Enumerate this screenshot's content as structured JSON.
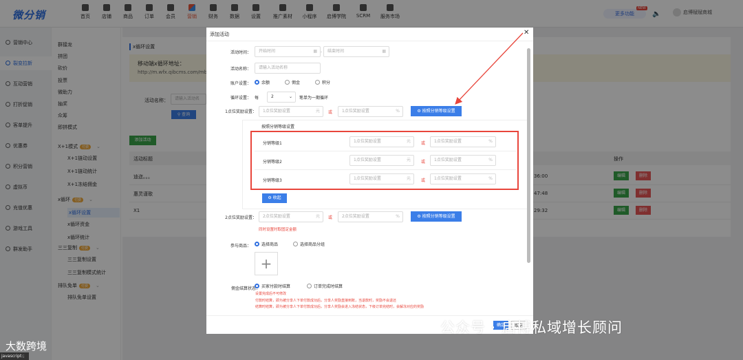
{
  "app": {
    "logo_text": "微分销",
    "account_name": "启博赋赋商城",
    "more_features": "更多功能",
    "new_badge": "NEW",
    "speaker_icon": "speaker-icon"
  },
  "topnav": [
    {
      "label": "首页",
      "icon": "home-icon"
    },
    {
      "label": "店铺",
      "icon": "shop-icon"
    },
    {
      "label": "商品",
      "icon": "goods-icon"
    },
    {
      "label": "订单",
      "icon": "order-icon"
    },
    {
      "label": "会员",
      "icon": "member-icon"
    },
    {
      "label": "营销",
      "icon": "marketing-icon"
    },
    {
      "label": "财务",
      "icon": "finance-icon"
    },
    {
      "label": "数据",
      "icon": "data-icon"
    },
    {
      "label": "设置",
      "icon": "settings-icon"
    },
    {
      "label": "推广素材",
      "icon": "promo-icon"
    },
    {
      "label": "小程序",
      "icon": "miniapp-icon"
    },
    {
      "label": "启博学院",
      "icon": "academy-icon"
    },
    {
      "label": "SCRM",
      "icon": "scrm-icon"
    },
    {
      "label": "服务市场",
      "icon": "market-icon"
    }
  ],
  "leftnav": [
    {
      "label": "营销中心"
    },
    {
      "label": "裂变拉新"
    },
    {
      "label": "互动营销"
    },
    {
      "label": "打折促销"
    },
    {
      "label": "客单提升"
    },
    {
      "label": "优惠券"
    },
    {
      "label": "积分营销"
    },
    {
      "label": "虚拟币"
    },
    {
      "label": "充值优惠"
    },
    {
      "label": "游戏工具"
    },
    {
      "label": "群发助手"
    }
  ],
  "subnav": {
    "items": [
      "群接龙",
      "拼团",
      "砍价",
      "投票",
      "微助力",
      "抽奖",
      "众筹",
      "即拼模式"
    ],
    "x1_mode": "X+1模式",
    "x1_children": [
      "X+1链动设置",
      "X+1链动统计",
      "X+1冻结佣金"
    ],
    "xloop": "x循环",
    "xloop_children": [
      "x循环设置",
      "x循环资金",
      "x循环统计"
    ],
    "triple": "三三复制",
    "triple_children": [
      "三三复制设置",
      "三三复制模式统计"
    ],
    "queue": "排队免单",
    "queue_children": [
      "排队免单设置"
    ],
    "tag": "付费"
  },
  "background": {
    "page_title": "x循环设置",
    "notice_line1": "移动端x循环地址：",
    "notice_line2": "http://m.wfx.qibcms.com/mb",
    "search_label": "活动名称：",
    "search_placeholder": "请输入活动名",
    "search_button": "查询",
    "add_button": "添加活动",
    "table_header_title": "活动标题",
    "table_header_ops": "操作",
    "rows": [
      {
        "title": "迪迩。。。",
        "time": "36:00"
      },
      {
        "title": "惠灵谨歌",
        "time": "47:48"
      },
      {
        "title": "X1",
        "time": "29:32"
      }
    ],
    "edit_label": "编辑",
    "delete_label": "删除"
  },
  "modal": {
    "title": "添加活动",
    "time_label": "活动时间：",
    "start_placeholder": "开始时间",
    "end_placeholder": "结束时间",
    "name_label": "活动名称：",
    "name_placeholder": "请输入活动名称",
    "account_label": "账户设置：",
    "account_options": [
      "余额",
      "佣金",
      "积分"
    ],
    "cycle_label": "循环设置：",
    "cycle_every": "每",
    "cycle_value": "2",
    "cycle_suffix": "笔单为一期循环",
    "reward1_label": "1点位奖励设置：",
    "reward1_amount_ph": "1点位奖励设置",
    "reward1_percent_ph": "1点位奖励设置",
    "or": "或",
    "yuan": "元",
    "percent": "%",
    "by_level_button": "按照分销等级设置",
    "level_section_title": "按照分销等级设置",
    "levels": [
      {
        "name": "分销等级1",
        "amount_ph": "1点位奖励设置",
        "percent_ph": "1点位奖励设置"
      },
      {
        "name": "分销等级2",
        "amount_ph": "1点位奖励设置",
        "percent_ph": "1点位奖励设置"
      },
      {
        "name": "分销等级3",
        "amount_ph": "1点位奖励设置",
        "percent_ph": "1点位奖励设置"
      }
    ],
    "collapse_button": "收起",
    "reward2_label": "2点位奖励设置：",
    "reward2_amount_ph": "2点位奖励设置",
    "reward2_percent_ph": "2点位奖励设置",
    "reward2_note": "同时设置时取固定金额",
    "goods_label": "参与商品：",
    "goods_options": [
      "选择商品",
      "选择商品分组"
    ],
    "settle_label": "佣金结算状态：",
    "settle_options": [
      "买家付款时结算",
      "订单完成时结算"
    ],
    "notes": [
      "设置完成后不可修改",
      "付款时结算，即为被分享人下单付款成功后，分享人奖励直接到账，当退款时，奖励不会退还",
      "结算时结算，即为被分享人下单付款成功后，分享人奖励会进入冻结状态，下级订单完结时，会解冻对应的奖励"
    ],
    "confirm_button": "确定",
    "cancel_button": "取消"
  },
  "watermark": {
    "right": "公众号 · 启博私域增长顾问",
    "left": "大数跨境"
  },
  "status_bar": "javascript:;",
  "colors": {
    "brand": "#2f6fe0",
    "active": "#e8563b",
    "highlight": "#e8453b"
  }
}
